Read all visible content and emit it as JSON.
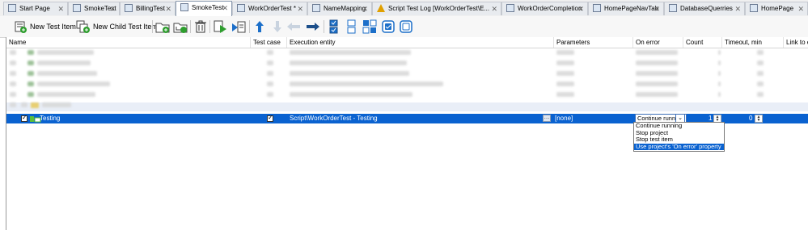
{
  "tabs": [
    {
      "label": "Start Page",
      "icon": "start-page-icon",
      "closable": true
    },
    {
      "label": "SmokeTest",
      "icon": "project-icon",
      "closable": true
    },
    {
      "label": "BillingTest",
      "icon": "project-icon",
      "closable": true
    },
    {
      "label": "SmokeTest",
      "icon": "project-icon",
      "closable": true,
      "active": true
    },
    {
      "label": "WorkOrderTest *",
      "icon": "script-icon",
      "closable": true
    },
    {
      "label": "NameMapping",
      "icon": "name-mapping-icon",
      "closable": true
    },
    {
      "label": "Script Test Log [WorkOrderTest\\E...",
      "icon": "warning-log-icon",
      "closable": true
    },
    {
      "label": "WorkOrderCompletion",
      "icon": "script-icon",
      "closable": true
    },
    {
      "label": "HomePageNavTab",
      "icon": "script-icon",
      "closable": true
    },
    {
      "label": "DatabaseQuerries",
      "icon": "script-icon",
      "closable": true
    },
    {
      "label": "HomePage",
      "icon": "script-icon",
      "closable": true
    }
  ],
  "toolbar": {
    "new_test_item": "New Test Item",
    "new_child_test_item": "New Child Test Item"
  },
  "columns": {
    "name": "Name",
    "test_case": "Test case",
    "execution_entity": "Execution entity",
    "parameters": "Parameters",
    "on_error": "On error",
    "count": "Count",
    "timeout": "Timeout, min",
    "link": "Link to external"
  },
  "selected_row": {
    "name": "Testing",
    "test_case_checked": true,
    "execution_entity": "Script\\WorkOrderTest - Testing",
    "parameters": "[none]",
    "on_error_value": "Continue runni",
    "count": "1",
    "timeout": "0"
  },
  "on_error_options": [
    "Continue running",
    "Stop project",
    "Stop test item",
    "Use project's 'On error' property"
  ],
  "colors": {
    "selection": "#0a62d0",
    "tab_bar": "#f0f0f0"
  }
}
